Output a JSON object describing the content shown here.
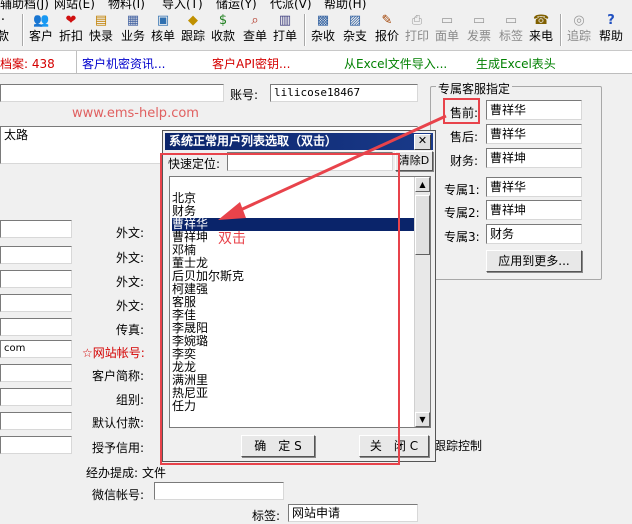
{
  "menu": [
    "辅助档(J)",
    "网站(E)",
    "物料(I)",
    "导入(T)",
    "储运(Y)",
    "代派(V)",
    "帮助(H)"
  ],
  "toolbar": [
    {
      "label": "款",
      "icon": "·"
    },
    {
      "label": "客户",
      "icon": "👥"
    },
    {
      "label": "折扣",
      "icon": "❤"
    },
    {
      "label": "快录",
      "icon": "▤"
    },
    {
      "label": "业务",
      "icon": "▦"
    },
    {
      "label": "核单",
      "icon": "▣"
    },
    {
      "label": "跟踪",
      "icon": "◆"
    },
    {
      "label": "收款",
      "icon": "$"
    },
    {
      "label": "查单",
      "icon": "⌕"
    },
    {
      "label": "打单",
      "icon": "▥"
    },
    {
      "label": "杂收",
      "icon": "▩"
    },
    {
      "label": "杂支",
      "icon": "▨"
    },
    {
      "label": "报价",
      "icon": "✎"
    },
    {
      "label": "打印",
      "icon": "⎙"
    },
    {
      "label": "面单",
      "icon": "▭"
    },
    {
      "label": "发票",
      "icon": "▭"
    },
    {
      "label": "标签",
      "icon": "▭"
    },
    {
      "label": "来电",
      "icon": "☎"
    },
    {
      "label": "追踪",
      "icon": "◎"
    },
    {
      "label": "帮助",
      "icon": "?"
    }
  ],
  "infobar": {
    "archive": "档案: 438",
    "secret": "客户机密资讯...",
    "api": "客户API密钥...",
    "excel_import": "从Excel文件导入...",
    "excel_generate": "生成Excel表头"
  },
  "form": {
    "account_label": "账号:",
    "account_value": "lilicose18467",
    "url_value": "www.ems-help.com",
    "address_value": "太路",
    "ext1_label": "外文:",
    "ext2_label": "外文:",
    "ext3_label": "外文:",
    "ext4_label": "外文:",
    "fax_label": "传真:",
    "site_account_label": "☆网站帐号:",
    "email_fragment": "com",
    "short_name_label": "客户简称:",
    "group_label": "组别:",
    "default_payment_label": "默认付款:",
    "credit_label": "授予信用:",
    "tracking_control": "跟踪控制",
    "commission_label": "经办提成:",
    "file_label": "文件",
    "wechat_label": "微信帐号:",
    "tag_label": "标签:",
    "tag_value": "网站申请"
  },
  "service": {
    "title": "专属客服指定",
    "presale_label": "售前:",
    "presale_value": "曹祥华",
    "aftersale_label": "售后:",
    "aftersale_value": "曹祥华",
    "finance_label": "财务:",
    "finance_value": "曹祥坤",
    "ex1_label": "专属1:",
    "ex1_value": "曹祥华",
    "ex2_label": "专属2:",
    "ex2_value": "曹祥坤",
    "ex3_label": "专属3:",
    "ex3_value": "财务",
    "apply_more": "应用到更多..."
  },
  "dialog": {
    "title": "系统正常用户列表选取（双击）",
    "close": "✕",
    "quick_locate_label": "快速定位:",
    "quick_locate_value": "",
    "clear_button": "清除D",
    "items": [
      "北京",
      "财务",
      "曹祥华",
      "曹祥坤",
      "邓楠",
      "董士龙",
      "后贝加尔斯克",
      "柯建强",
      "客服",
      "李佳",
      "李晟阳",
      "李婉璐",
      "李奕",
      "龙龙",
      "满洲里",
      "热尼亚",
      "任力"
    ],
    "selected_index": 2,
    "ok_button": "确　定 S",
    "close_button": "关　闭 C"
  },
  "annotation": {
    "double_click": "双击"
  },
  "colors": {
    "selection": "#0a246a",
    "annotation": "#e8434b",
    "link_blue": "#0000cc",
    "link_red": "#d40000",
    "link_green": "#008000"
  }
}
